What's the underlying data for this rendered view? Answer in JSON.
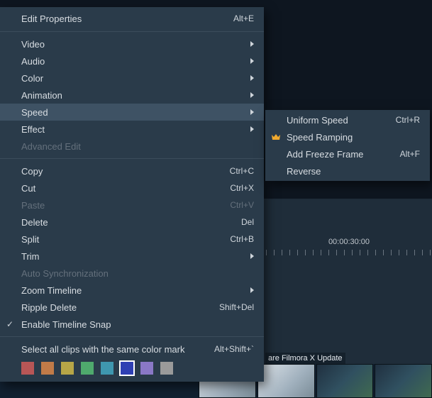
{
  "timeline": {
    "time_label": "00:00:30:00"
  },
  "thumb_strip": {
    "label": "are Filmora X Update"
  },
  "menu": {
    "edit_properties": {
      "label": "Edit Properties",
      "shortcut": "Alt+E"
    },
    "video": "Video",
    "audio": "Audio",
    "color": "Color",
    "animation": "Animation",
    "speed": "Speed",
    "effect": "Effect",
    "advanced_edit": "Advanced Edit",
    "copy": {
      "label": "Copy",
      "shortcut": "Ctrl+C"
    },
    "cut": {
      "label": "Cut",
      "shortcut": "Ctrl+X"
    },
    "paste": {
      "label": "Paste",
      "shortcut": "Ctrl+V"
    },
    "delete": {
      "label": "Delete",
      "shortcut": "Del"
    },
    "split": {
      "label": "Split",
      "shortcut": "Ctrl+B"
    },
    "trim": "Trim",
    "auto_sync": "Auto Synchronization",
    "zoom_timeline": "Zoom Timeline",
    "ripple_delete": {
      "label": "Ripple Delete",
      "shortcut": "Shift+Del"
    },
    "enable_snap": "Enable Timeline Snap",
    "select_color_mark": {
      "label": "Select all clips with the same color mark",
      "shortcut": "Alt+Shift+`"
    }
  },
  "speed_submenu": {
    "uniform": {
      "label": "Uniform Speed",
      "shortcut": "Ctrl+R"
    },
    "ramping": "Speed Ramping",
    "freeze": {
      "label": "Add Freeze Frame",
      "shortcut": "Alt+F"
    },
    "reverse": "Reverse"
  },
  "color_swatches": [
    {
      "name": "red",
      "hex": "#b85656"
    },
    {
      "name": "orange",
      "hex": "#c17b48"
    },
    {
      "name": "olive",
      "hex": "#b7a647"
    },
    {
      "name": "green",
      "hex": "#4faa6d"
    },
    {
      "name": "teal",
      "hex": "#3f97af"
    },
    {
      "name": "blue",
      "hex": "#2f3fb3",
      "selected": true
    },
    {
      "name": "purple",
      "hex": "#8a78c6"
    },
    {
      "name": "gray",
      "hex": "#9a9a9a"
    }
  ]
}
